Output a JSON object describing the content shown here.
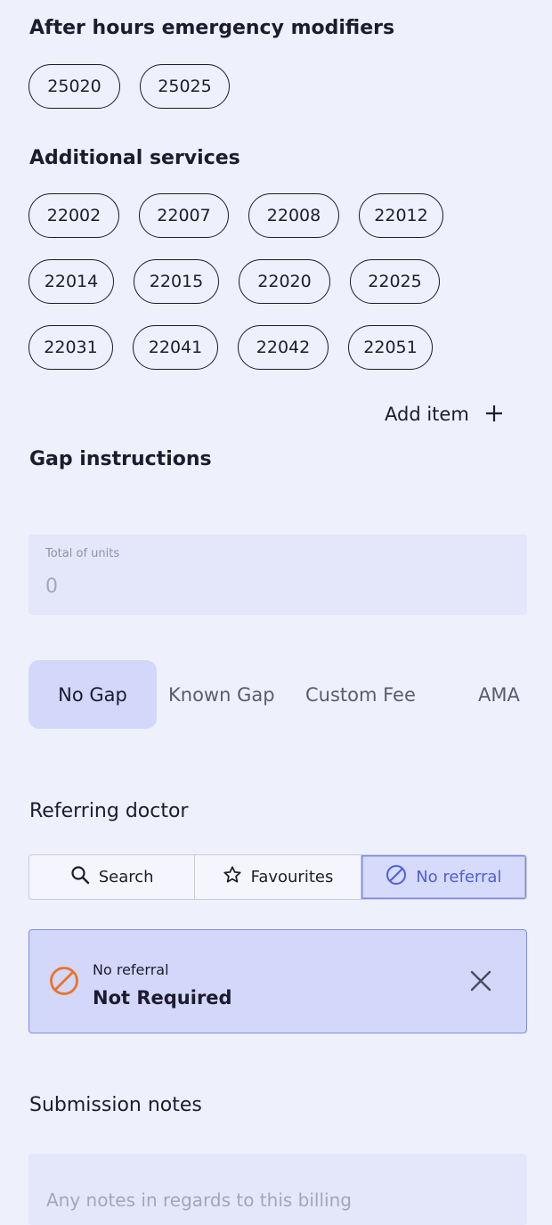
{
  "after_hours": {
    "title": "After hours emergency modifiers",
    "chips": [
      "25020",
      "25025"
    ]
  },
  "additional": {
    "title": "Additional services",
    "rows": [
      [
        "22002",
        "22007",
        "22008",
        "22012"
      ],
      [
        "22014",
        "22015",
        "22020",
        "22025"
      ],
      [
        "22031",
        "22041",
        "22042",
        "22051"
      ]
    ],
    "add_label": "Add item"
  },
  "gap": {
    "title": "Gap instructions",
    "units_label": "Total of units",
    "units_value": "0",
    "tabs": [
      "No Gap",
      "Known Gap",
      "Custom Fee",
      "AMA"
    ],
    "active_tab": "No Gap"
  },
  "referring": {
    "title": "Referring doctor",
    "options": [
      "Search",
      "Favourites",
      "No referral"
    ],
    "active": "No referral",
    "card_label": "No referral",
    "card_value": "Not Required"
  },
  "submission": {
    "title": "Submission notes",
    "placeholder": "Any notes in regards to this billing"
  },
  "colors": {
    "background": "#eef0fc",
    "accent": "#4d5ee0",
    "warning": "#e8742b"
  }
}
